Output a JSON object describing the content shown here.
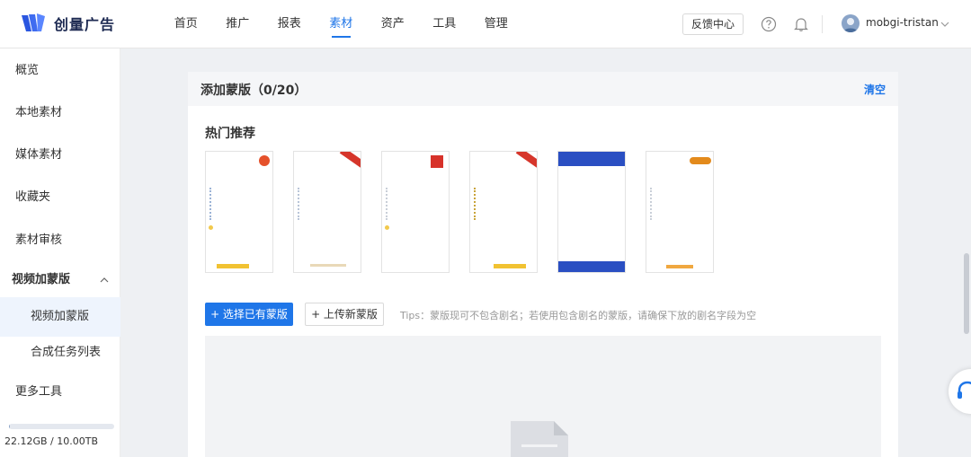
{
  "brand": {
    "name": "创量广告"
  },
  "nav": {
    "items": [
      "首页",
      "推广",
      "报表",
      "素材",
      "资产",
      "工具",
      "管理"
    ],
    "active_index": 3
  },
  "header": {
    "feedback_label": "反馈中心",
    "username": "mobgi-tristan"
  },
  "sidebar": {
    "items": {
      "overview": "概览",
      "local": "本地素材",
      "media": "媒体素材",
      "favorites": "收藏夹",
      "review": "素材审核",
      "video_mask_group": "视频加蒙版",
      "video_mask": "视频加蒙版",
      "compose_tasks": "合成任务列表",
      "more_tools": "更多工具"
    },
    "storage": {
      "used_fraction": 0.0022,
      "label": "22.12GB / 10.00TB"
    }
  },
  "panel": {
    "title": "添加蒙版（0/20）",
    "clear_label": "清空",
    "section_title": "热门推荐",
    "select_button": "+ 选择已有蒙版",
    "upload_button": "+ 上传新蒙版",
    "tips": "Tips：蒙版现可不包含剧名；若使用包含剧名的蒙版，请确保下放的剧名字段为空"
  },
  "colors": {
    "accent": "#1f76e8",
    "nav_active": "#1f76e8"
  }
}
